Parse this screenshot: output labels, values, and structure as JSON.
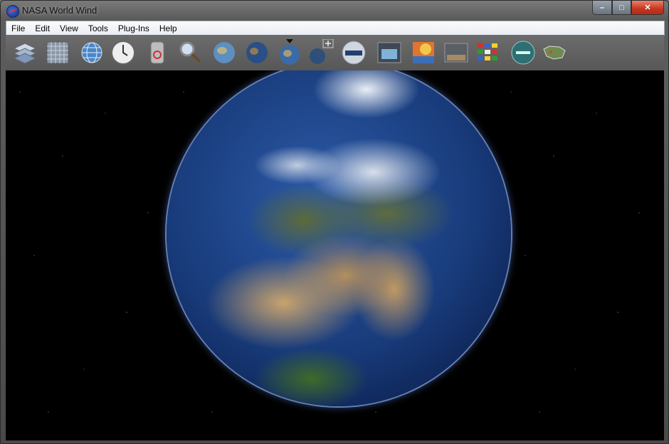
{
  "window": {
    "title": "NASA World Wind"
  },
  "menu": [
    "File",
    "Edit",
    "View",
    "Tools",
    "Plug-Ins",
    "Help"
  ],
  "toolbar": {
    "items": [
      "layers-icon",
      "grid-icon",
      "wireframe-globe-icon",
      "clock-icon",
      "scale-icon",
      "magnifier-icon",
      "earth-blue-marble-icon",
      "earth-dark-icon",
      "earth-selected-icon",
      "add-globe-icon",
      "modis-icon",
      "wms-icon",
      "heatmap-icon",
      "astronomy-icon",
      "flags-icon",
      "landmarks-icon",
      "usa-map-icon"
    ]
  },
  "window_buttons": {
    "minimize": "–",
    "maximize": "□",
    "close": "✕"
  },
  "icons": {
    "app": "nasa-logo-icon"
  }
}
